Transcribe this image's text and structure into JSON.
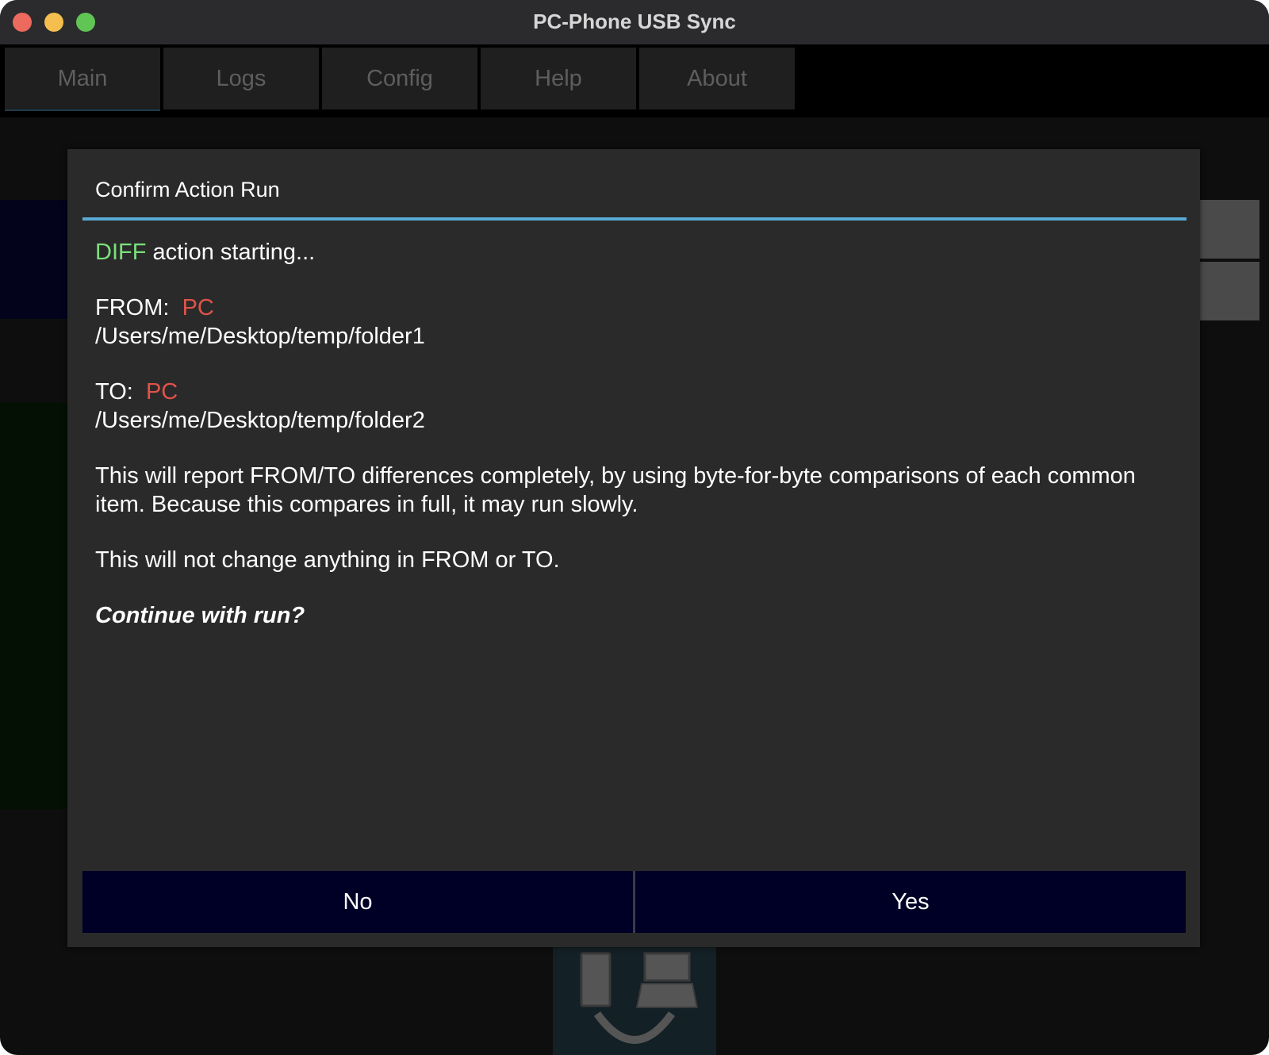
{
  "window": {
    "title": "PC-Phone USB Sync"
  },
  "tabs": [
    {
      "label": "Main"
    },
    {
      "label": "Logs"
    },
    {
      "label": "Config"
    },
    {
      "label": "Help"
    },
    {
      "label": "About"
    }
  ],
  "dialog": {
    "title": "Confirm Action Run",
    "action": "DIFF",
    "action_suffix": " action starting...",
    "from_label": "FROM:",
    "from_device": "PC",
    "from_path": "/Users/me/Desktop/temp/folder1",
    "to_label": "TO:",
    "to_device": "PC",
    "to_path": "/Users/me/Desktop/temp/folder2",
    "description": "This will report FROM/TO differences completely, by using byte-for-byte comparisons of each common item.  Because this compares in full, it may run slowly.",
    "note": "This will not change anything in FROM or TO.",
    "question": "Continue with run?",
    "no_label": "No",
    "yes_label": "Yes"
  },
  "colors": {
    "action": "#7be07b",
    "device": "#e0534a",
    "accent": "#5aa9d6",
    "button_bg": "#000027"
  }
}
